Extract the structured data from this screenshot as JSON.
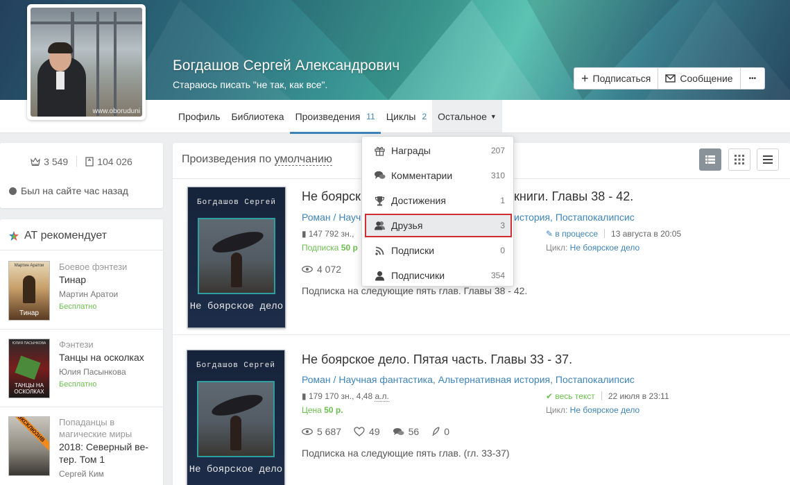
{
  "profile": {
    "name": "Богдашов Сергей Александрович",
    "status": "Стараюсь писать \"не так, как все\".",
    "avatar_watermark": "www.oboruduni"
  },
  "actions": {
    "subscribe": "Подписаться",
    "message": "Сообщение",
    "more": "•••"
  },
  "nav": {
    "tabs": [
      {
        "label": "Профиль"
      },
      {
        "label": "Библиотека"
      },
      {
        "label": "Произведения",
        "count": "11"
      },
      {
        "label": "Циклы",
        "count": "2"
      }
    ],
    "more_label": "Остальное"
  },
  "dropdown": {
    "items": [
      {
        "label": "Награды",
        "count": "207"
      },
      {
        "label": "Комментарии",
        "count": "310"
      },
      {
        "label": "Достижения",
        "count": "1"
      },
      {
        "label": "Друзья",
        "count": "3"
      },
      {
        "label": "Подписки",
        "count": "0"
      },
      {
        "label": "Подписчики",
        "count": "354"
      }
    ]
  },
  "sidebar": {
    "stats": {
      "rating": "3 549",
      "views": "104 026"
    },
    "online": "Был на сайте час назад",
    "recommend_title": "АТ рекомендует",
    "recs": [
      {
        "genre": "Боевое фэнтези",
        "title": "Тинар",
        "author": "Мартин Аратои",
        "price": "Бесплатно",
        "cover_top": "Мартин Аратои",
        "cover_bottom": "Тинар"
      },
      {
        "genre": "Фэнтези",
        "title": "Танцы на осколках",
        "author": "Юлия Пасынкова",
        "price": "Бесплатно",
        "cover_top": "ЮЛИЯ ПАСЫНКОВА",
        "cover_bottom": "ТАНЦЫ НА ОСКОЛКАХ"
      },
      {
        "genre": "Попаданцы в магические миры",
        "title": "2018: Северный ве-тер. Том 1",
        "author": "Сергей Ким",
        "badge": "ЭКСКЛЮЗИВ"
      }
    ]
  },
  "works": {
    "sort_prefix": "Произведения по ",
    "sort_value": "умолчанию",
    "items": [
      {
        "title": "Не боярск",
        "title_end": "книги. Главы 38 - 42.",
        "genre_start": "Роман / Научн",
        "genres_end": "история, Постапокалипсис",
        "size": "147 792 зн.,",
        "price_label": "Подписка",
        "price_value": "50 р",
        "status": "в процессе",
        "date": "13 августа в 20:05",
        "cycle_label": "Цикл:",
        "cycle": "Не боярское дело",
        "views": "4 072",
        "desc": "Подписка на следующие пять глав. Главы 38 - 42.",
        "cover_top": "Богдашов Сергей",
        "cover_bottom": "Не боярское дело"
      },
      {
        "title": "Не боярское дело. Пятая часть. Главы 33 - 37.",
        "genre1": "Роман",
        "genre2": "Научная фантастика",
        "genre3": "Альтернативная история",
        "genre4": "Постапокалипсис",
        "size": "179 170 зн., 4,48",
        "size_unit": "а.л.",
        "price_label": "Цена",
        "price_value": "50 р.",
        "status": "весь текст",
        "date": "22 июля в 23:11",
        "cycle_label": "Цикл:",
        "cycle": "Не боярское дело",
        "views": "5 687",
        "likes": "49",
        "comments": "56",
        "rewards": "0",
        "desc": "Подписка на следующие пять глав. (гл. 33-37)",
        "cover_top": "Богдашов Сергей",
        "cover_bottom": "Не боярское дело"
      }
    ]
  },
  "colors": {
    "accent": "#3e84b7",
    "green": "#6bbf4f",
    "highlight": "#d02e2e"
  }
}
